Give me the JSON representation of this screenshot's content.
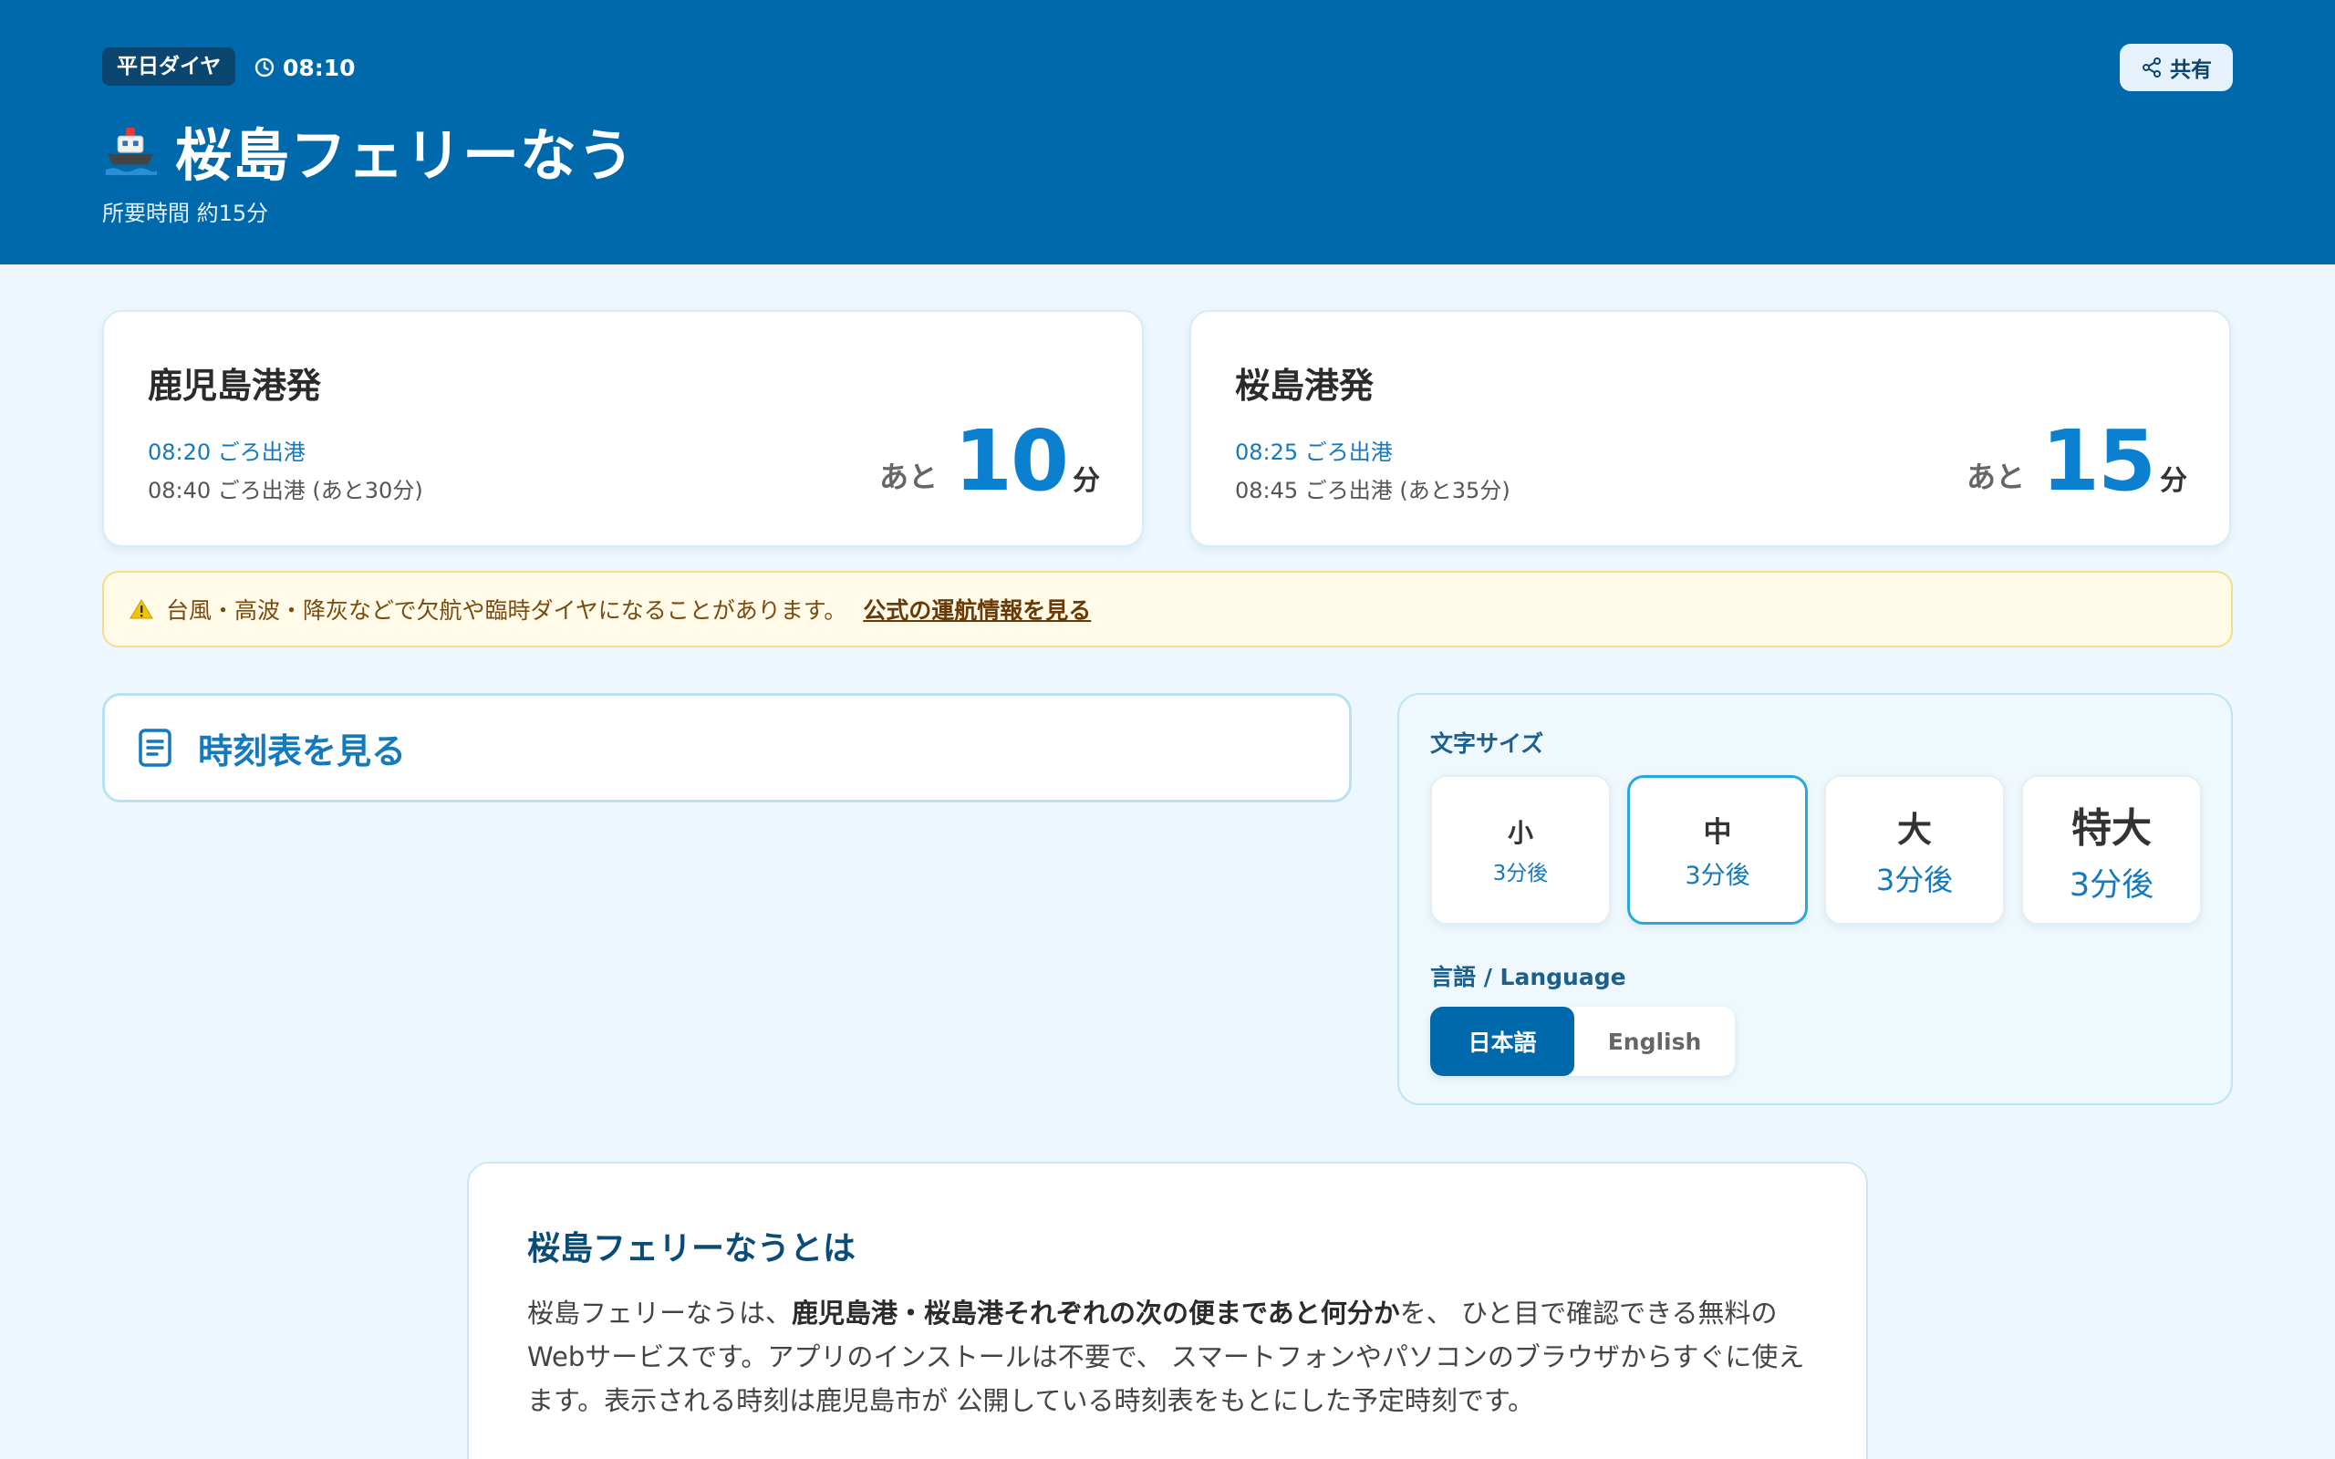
{
  "header": {
    "schedule_badge": "平日ダイヤ",
    "time": "08:10",
    "title": "桜島フェリーなう",
    "subtitle": "所要時間 約15分",
    "share_label": "共有"
  },
  "departures": [
    {
      "port": "鹿児島港発",
      "next": "08:20 ごろ出港",
      "after": "08:40 ごろ出港 (あと30分)",
      "prefix": "あと",
      "minutes": "10",
      "unit": "分"
    },
    {
      "port": "桜島港発",
      "next": "08:25 ごろ出港",
      "after": "08:45 ごろ出港 (あと35分)",
      "prefix": "あと",
      "minutes": "15",
      "unit": "分"
    }
  ],
  "warning": {
    "text": "台風・高波・降灰などで欠航や臨時ダイヤになることがあります。",
    "link": "公式の運航情報を見る"
  },
  "timetable": {
    "label": "時刻表を見る"
  },
  "settings": {
    "font_size_label": "文字サイズ",
    "font_sizes": [
      {
        "name": "小",
        "sample": "3分後"
      },
      {
        "name": "中",
        "sample": "3分後"
      },
      {
        "name": "大",
        "sample": "3分後"
      },
      {
        "name": "特大",
        "sample": "3分後"
      }
    ],
    "selected_font_size": "中",
    "language_label": "言語 / Language",
    "languages": [
      "日本語",
      "English"
    ],
    "selected_language": "日本語"
  },
  "about": {
    "title": "桜島フェリーなうとは",
    "text_1": "桜島フェリーなうは、",
    "text_bold": "鹿児島港・桜島港それぞれの次の便まであと何分か",
    "text_2": "を、 ひと目で確認できる無料のWebサービスです。アプリのインストールは不要で、 スマートフォンやパソコンのブラウザからすぐに使えます。表示される時刻は鹿児島市が 公開している時刻表をもとにした予定時刻です。"
  },
  "colors": {
    "header_bg": "#0069ab",
    "accent": "#0b7fd0",
    "page_bg": "#eef7fd",
    "warning_bg": "#fffbe8"
  }
}
